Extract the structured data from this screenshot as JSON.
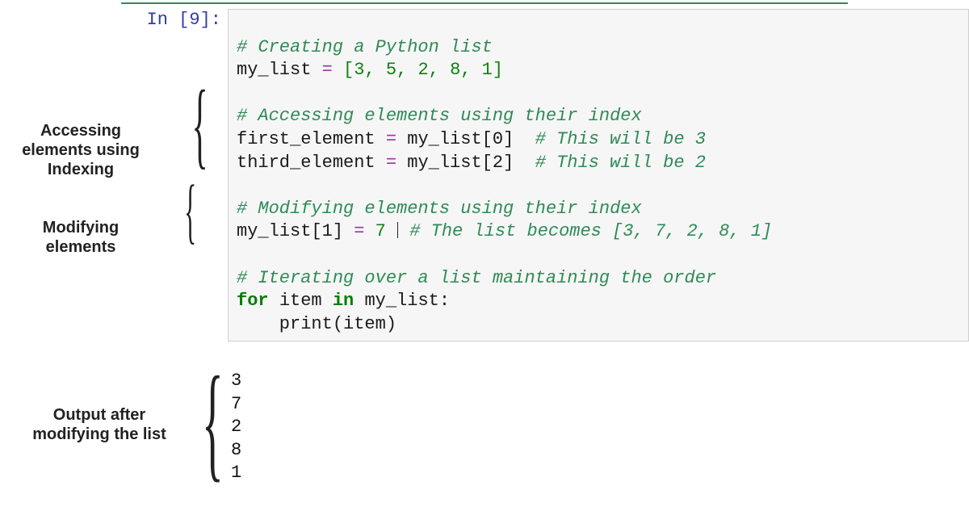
{
  "prompt": "In [9]:",
  "code": {
    "l01_comment": "# Creating a Python list",
    "l02_var": "my_list",
    "l02_rhs": "[3, 5, 2, 8, 1]",
    "l04_comment": "# Accessing elements using their index",
    "l05_var": "first_element",
    "l05_rhs": "my_list[0]",
    "l05_trail": "# This will be 3",
    "l06_var": "third_element",
    "l06_rhs": "my_list[2]",
    "l06_trail": "# This will be 2",
    "l08_comment": "# Modifying elements using their index",
    "l09_lhs": "my_list[1]",
    "l09_rhs": "7",
    "l09_trail": "# The list becomes [3, 7, 2, 8, 1]",
    "l11_comment": "# Iterating over a list maintaining the order",
    "l12_for": "for",
    "l12_item": "item",
    "l12_in": "in",
    "l12_iter": "my_list:",
    "l13_body": "    print(item)"
  },
  "output": {
    "o1": "3",
    "o2": "7",
    "o3": "2",
    "o4": "8",
    "o5": "1"
  },
  "annotations": {
    "a1": "Accessing elements using Indexing",
    "a2": "Modifying elements",
    "a3": "Output after modifying the list"
  }
}
